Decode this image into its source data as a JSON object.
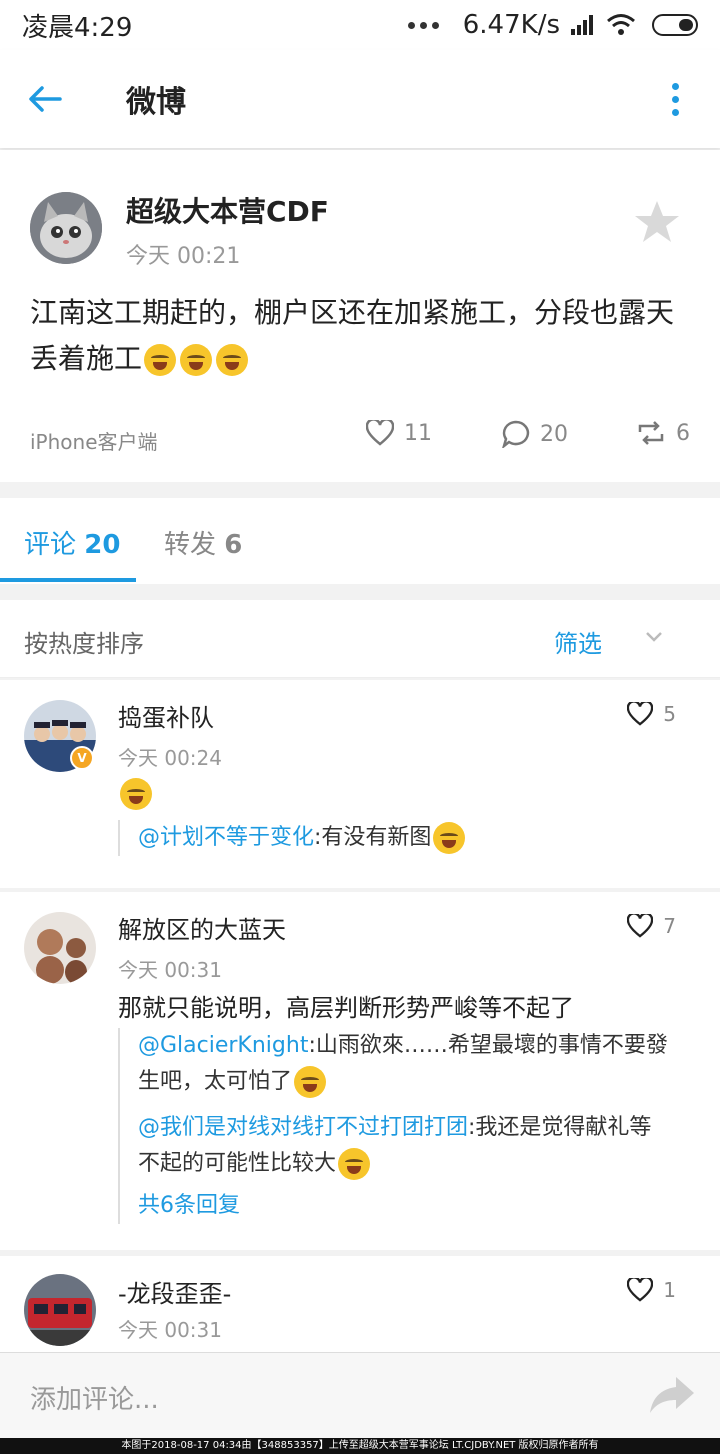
{
  "status_bar": {
    "time": "凌晨4:29",
    "speed": "6.47K/s"
  },
  "nav": {
    "title": "微博"
  },
  "post": {
    "author": "超级大本营CDF",
    "time": "今天 00:21",
    "content": "江南这工期赶的，棚户区还在加紧施工，分段也露天丢着施工",
    "source": "iPhone客户端",
    "likes": "11",
    "comments": "20",
    "reposts": "6"
  },
  "tabs": {
    "comments_label": "评论",
    "comments_count": "20",
    "reposts_label": "转发",
    "reposts_count": "6"
  },
  "sort": {
    "label": "按热度排序",
    "filter": "筛选"
  },
  "comments": [
    {
      "name": "捣蛋补队",
      "time": "今天 00:24",
      "likes": "5",
      "reply_mention": "@计划不等于变化",
      "reply_text": ":有没有新图"
    },
    {
      "name": "解放区的大蓝天",
      "time": "今天 00:31",
      "likes": "7",
      "text": "那就只能说明，高层判断形势严峻等不起了",
      "reply1_mention": "@GlacierKnight",
      "reply1_text": ":山雨欲來……希望最壞的事情不要發生吧，太可怕了",
      "reply2_mention": "@我们是对线对线打不过打团打团",
      "reply2_text": ":我还是觉得献礼等不起的可能性比较大",
      "more": "共6条回复"
    },
    {
      "name": "-龙段歪歪-",
      "time": "今天 00:31",
      "likes": "1"
    }
  ],
  "bottom": {
    "placeholder": "添加评论..."
  },
  "footer": "本图于2018-08-17 04:34由【348853357】上传至超级大本营军事论坛 LT.CJDBY.NET 版权归原作者所有",
  "colors": {
    "accent": "#1e9ae0",
    "verified_badge": "#f5a623"
  }
}
